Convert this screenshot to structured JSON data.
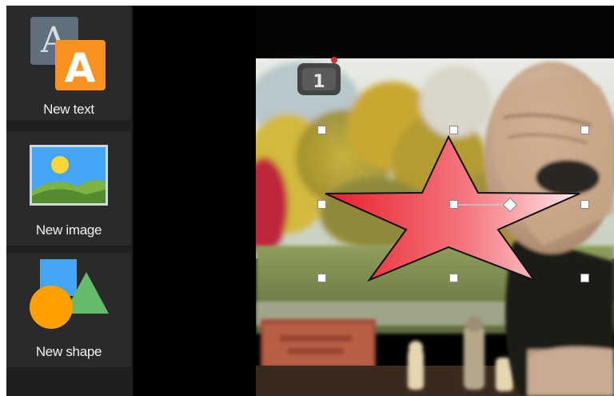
{
  "tools": [
    {
      "label": "New text",
      "icon": "text-icon"
    },
    {
      "label": "New image",
      "icon": "image-icon"
    },
    {
      "label": "New shape",
      "icon": "shape-icon"
    }
  ],
  "canvas": {
    "selected_shape": "star",
    "selected_shape_fill": [
      "#e81f2a",
      "#ffe7ea"
    ],
    "selected_shape_stroke": "#111111",
    "background": "video-frame",
    "overlay_icon": "timer-icon"
  }
}
